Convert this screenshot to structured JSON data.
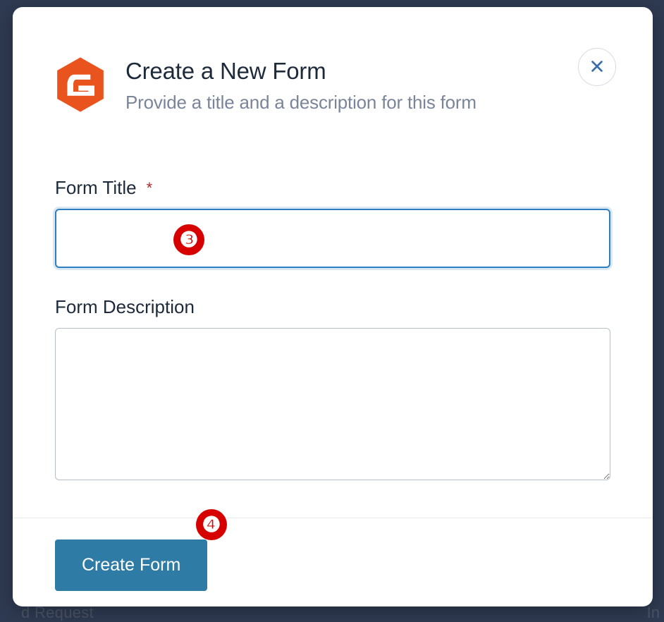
{
  "modal": {
    "title": "Create a New Form",
    "subtitle": "Provide a title and a description for this form",
    "close_label": "Close"
  },
  "fields": {
    "title_label": "Form Title",
    "title_required_marker": "*",
    "title_value": "",
    "description_label": "Form Description",
    "description_value": ""
  },
  "footer": {
    "submit_label": "Create Form"
  },
  "annotations": {
    "marker_3": "❸",
    "marker_4": "❹"
  },
  "background": {
    "bottom_left_fragment": "d Request",
    "bottom_right_fragment": "In"
  },
  "colors": {
    "brand_orange": "#e9541e",
    "accent_blue": "#2d7fc1",
    "button_blue": "#2e7ba5",
    "close_x": "#3a6ea8",
    "marker_red": "#d60000"
  }
}
